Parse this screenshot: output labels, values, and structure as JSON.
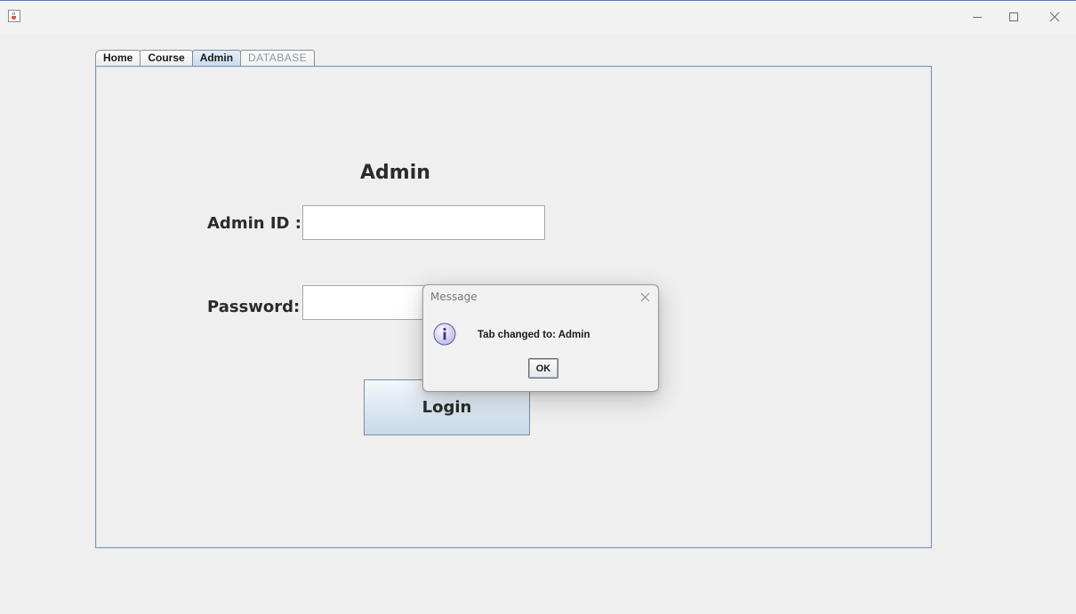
{
  "window": {
    "app_icon": "java-cup-icon",
    "controls": [
      "minimize-icon",
      "maximize-icon",
      "close-icon"
    ]
  },
  "tabs": [
    {
      "label": "Home",
      "selected": false,
      "enabled": true
    },
    {
      "label": "Course",
      "selected": false,
      "enabled": true
    },
    {
      "label": "Admin",
      "selected": true,
      "enabled": true
    },
    {
      "label": "DATABASE",
      "selected": false,
      "enabled": false
    }
  ],
  "admin_form": {
    "heading": "Admin",
    "admin_id_label": "Admin ID :",
    "admin_id_value": "",
    "password_label": "Password:",
    "password_value": "",
    "login_label": "Login"
  },
  "dialog": {
    "title": "Message",
    "icon": "info-icon",
    "message": "Tab changed to: Admin",
    "ok_label": "OK"
  },
  "colors": {
    "accent_border": "#7b97b9",
    "selected_tab": "#c9dbee",
    "background": "#efefef"
  }
}
